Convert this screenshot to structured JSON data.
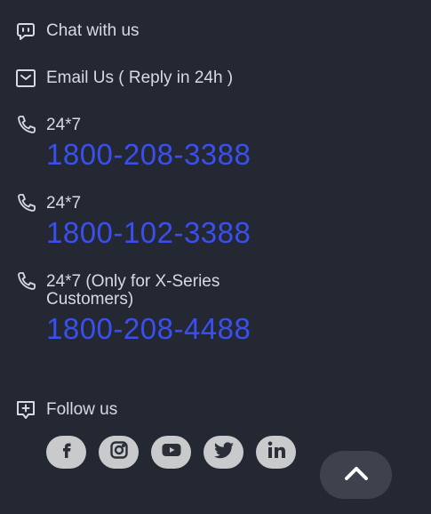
{
  "contact": {
    "chat_label": "Chat with us",
    "email_label": "Email Us ( Reply in 24h )",
    "phones": [
      {
        "availability": "24*7",
        "number": "1800-208-3388"
      },
      {
        "availability": "24*7",
        "number": "1800-102-3388"
      },
      {
        "availability_line1": "24*7 (Only for X-Series",
        "availability_line2": "Customers)",
        "number": "1800-208-4488"
      }
    ]
  },
  "follow": {
    "label": "Follow us",
    "socials": [
      "facebook-icon",
      "instagram-icon",
      "youtube-icon",
      "twitter-icon",
      "linkedin-icon"
    ]
  },
  "colors": {
    "background": "#242833",
    "phone_link": "#3a4ff0",
    "social_bg": "#c9cacc",
    "back_to_top_bg": "#3d424d"
  }
}
